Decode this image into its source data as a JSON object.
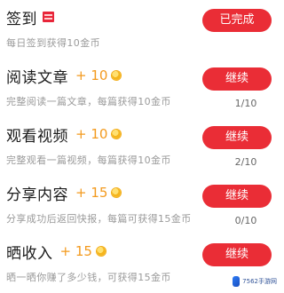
{
  "tasks": [
    {
      "name": "签到",
      "reward": "",
      "icon": "gift-icon",
      "desc": "每日签到获得10金币",
      "button": "已完成",
      "progress": ""
    },
    {
      "name": "阅读文章",
      "reward": "+ 10",
      "icon": "coin-icon",
      "desc": "完整阅读一篇文章，每篇获得10金币",
      "button": "继续",
      "progress": "1/10"
    },
    {
      "name": "观看视频",
      "reward": "+ 10",
      "icon": "coin-icon",
      "desc": "完整观看一篇视频，每篇获得10金币",
      "button": "继续",
      "progress": "2/10"
    },
    {
      "name": "分享内容",
      "reward": "+ 15",
      "icon": "coin-icon",
      "desc": "分享成功后返回快报，每篇可获得15金币",
      "button": "继续",
      "progress": "0/10"
    },
    {
      "name": "晒收入",
      "reward": "+ 15",
      "icon": "coin-icon",
      "desc": "晒一晒你赚了多少钱，可获得15金币",
      "button": "继续",
      "progress": ""
    }
  ],
  "watermark": {
    "text": "7562手游网"
  },
  "colors": {
    "button_red": "#ea2d36",
    "reward_orange": "#f39a1e",
    "desc_gray": "#9a9a9a"
  }
}
